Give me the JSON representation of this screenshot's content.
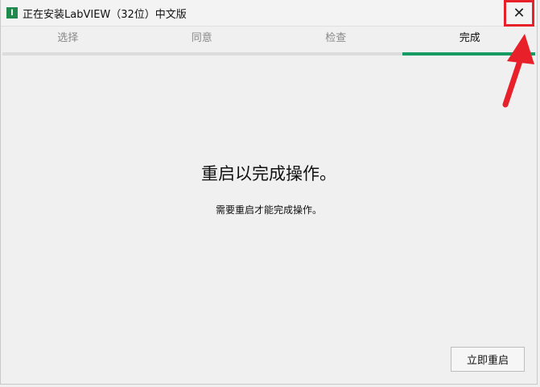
{
  "window": {
    "title": "正在安装LabVIEW（32位）中文版",
    "logo_letter": "l"
  },
  "tabs": [
    {
      "label": "选择"
    },
    {
      "label": "同意"
    },
    {
      "label": "检查"
    },
    {
      "label": "完成"
    }
  ],
  "progress": {
    "percent": 100,
    "active_step": 4,
    "total_steps": 4
  },
  "main": {
    "heading": "重启以完成操作。",
    "message": "需要重启才能完成操作。"
  },
  "buttons": {
    "restart": "立即重启",
    "close": "✕"
  },
  "colors": {
    "accent": "#169b62",
    "annotation": "#e8202a"
  }
}
